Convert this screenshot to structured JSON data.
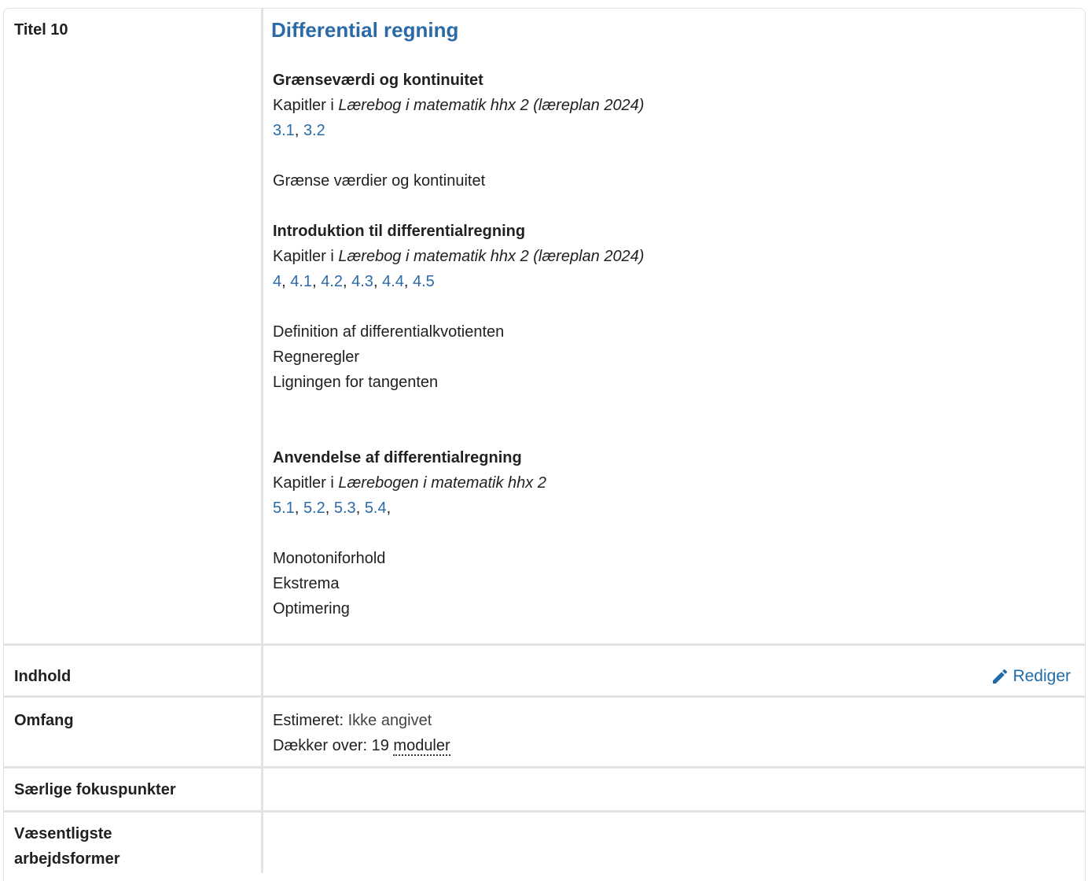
{
  "rows": {
    "titel": {
      "label": "Titel 10"
    },
    "indhold": {
      "label": "Indhold",
      "edit_label": "Rediger"
    },
    "omfang": {
      "label": "Omfang",
      "estimated_prefix": "Estimeret: ",
      "estimated_value": "Ikke angivet",
      "covers_prefix": "Dækker over: ",
      "covers_count": "19",
      "covers_unit": "moduler"
    },
    "fokus": {
      "label": "Særlige fokuspunkter"
    },
    "arbejdsformer": {
      "label_line1": "Væsentligste",
      "label_line2": "arbejdsformer"
    }
  },
  "unit": {
    "title": "Differential regning",
    "sections": [
      {
        "heading": "Grænseværdi og kontinuitet",
        "book_prefix": "Kapitler i ",
        "book_title": "Lærebog i matematik hhx 2 (læreplan 2024)",
        "chapters": [
          "3.1",
          "3.2"
        ],
        "notes": [
          "Grænse værdier og kontinuitet"
        ]
      },
      {
        "heading": "Introduktion til differentialregning",
        "book_prefix": "Kapitler i ",
        "book_title": "Lærebog i matematik hhx 2 (læreplan 2024)",
        "chapters": [
          "4",
          "4.1",
          "4.2",
          "4.3",
          "4.4",
          "4.5"
        ],
        "notes": [
          "Definition af differentialkvotienten",
          "Regneregler",
          "Ligningen for tangenten"
        ]
      },
      {
        "heading": "Anvendelse af differentialregning",
        "book_prefix": "Kapitler i ",
        "book_title": "Lærebogen i matematik hhx 2",
        "chapters": [
          "5.1",
          "5.2",
          "5.3",
          "5.4"
        ],
        "trailing": ",",
        "notes": [
          "Monotoniforhold",
          "Ekstrema",
          "Optimering"
        ]
      }
    ]
  },
  "colors": {
    "link": "#2b6aa6",
    "title": "#2b6aa6",
    "border": "#e3e3e3"
  },
  "icons": {
    "edit": "pencil-icon"
  }
}
